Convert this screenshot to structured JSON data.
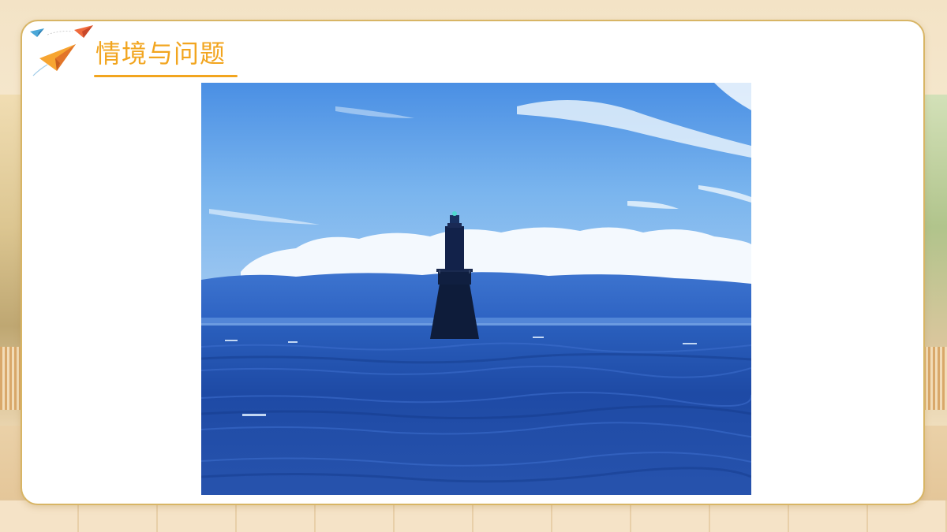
{
  "slide": {
    "title": "情境与问题",
    "photo_subject": "lighthouse-at-sea"
  },
  "colors": {
    "title": "#f2a51f",
    "card_border": "#d8b565",
    "sky_top": "#4f97e6",
    "sea": "#1d4fae"
  }
}
